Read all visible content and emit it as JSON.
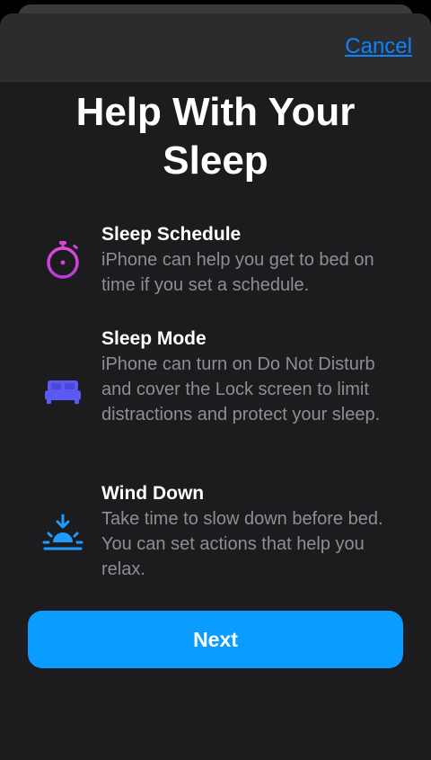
{
  "nav": {
    "cancel_label": "Cancel"
  },
  "title": "Help With Your Sleep",
  "features": [
    {
      "icon": "stopwatch-icon",
      "title": "Sleep Schedule",
      "description": "iPhone can help you get to bed on time if you set a schedule."
    },
    {
      "icon": "bed-icon",
      "title": "Sleep Mode",
      "description": "iPhone can turn on Do Not Disturb and cover the Lock screen to limit distractions and protect your sleep."
    },
    {
      "icon": "sunset-icon",
      "title": "Wind Down",
      "description": "Take time to slow down before bed. You can set actions that help you relax."
    }
  ],
  "next_label": "Next",
  "colors": {
    "accent": "#0a84ff",
    "button": "#0a9dff",
    "background": "#1c1c1e"
  }
}
